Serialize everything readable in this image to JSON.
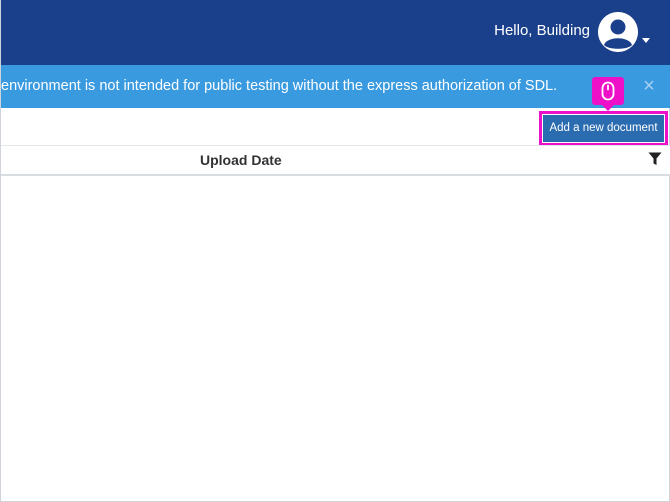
{
  "header": {
    "greeting": "Hello, Building",
    "avatar_icon": "user-avatar-icon",
    "menu_icon": "caret-down-icon",
    "background": "#1a3f8b"
  },
  "notice": {
    "text": "environment is not intended for public testing without the express authorization of SDL.",
    "close_label": "×",
    "background": "#3a9ae0"
  },
  "toolbar": {
    "add_document_label": "Add a new document",
    "highlight_color": "#ee10c8",
    "click_indicator_icon": "mouse-icon"
  },
  "table": {
    "columns": [
      "Upload Date"
    ],
    "filter_icon": "filter-icon",
    "rows": []
  }
}
